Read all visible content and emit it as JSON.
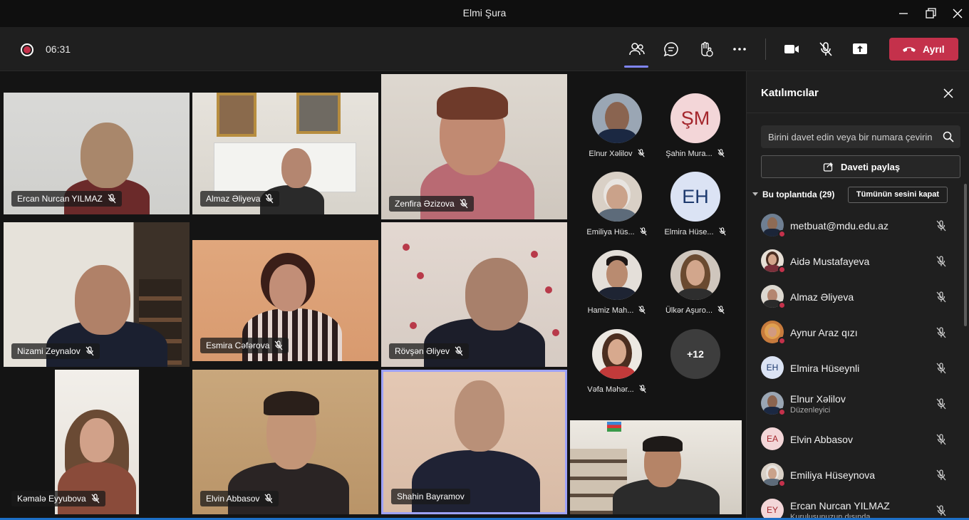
{
  "window": {
    "title": "Elmi Şura"
  },
  "toolbar": {
    "timer": "06:31",
    "leave_label": "Ayrıl"
  },
  "tiles": [
    {
      "name": "Ercan Nurcan YILMAZ"
    },
    {
      "name": "Almaz Əliyeva"
    },
    {
      "name": "Zenfira Əzizova"
    },
    {
      "name": "Nizami Zeynalov"
    },
    {
      "name": "Esmira Cəfərova"
    },
    {
      "name": "Rövşən Əliyev"
    },
    {
      "name": "Kəmalə Eyyubova"
    },
    {
      "name": "Elvin Abbasov"
    },
    {
      "name": "Shahin Bayramov"
    }
  ],
  "avatars": [
    {
      "name": "Elnur Xəlilov"
    },
    {
      "name": "Şahin Mura...",
      "initials": "ŞM"
    },
    {
      "name": "Emiliya Hüs..."
    },
    {
      "name": "Elmira Hüse...",
      "initials": "EH"
    },
    {
      "name": "Hamiz Mah..."
    },
    {
      "name": "Ülkər Aşuro..."
    },
    {
      "name": "Vəfa Məhər..."
    },
    {
      "more": "+12"
    }
  ],
  "panel": {
    "title": "Katılımcılar",
    "search_placeholder": "Birini davet edin veya bir numara çevirin",
    "share_label": "Daveti paylaş",
    "group_label": "Bu toplantıda (29)",
    "mute_all_label": "Tümünün sesini kapat",
    "participants": [
      {
        "name": "metbuat@mdu.edu.az"
      },
      {
        "name": "Aidə Mustafayeva"
      },
      {
        "name": "Almaz Əliyeva"
      },
      {
        "name": "Aynur Araz qızı"
      },
      {
        "name": "Elmira Hüseynli",
        "initials": "EH"
      },
      {
        "name": "Elnur Xəlilov",
        "role": "Düzenleyici"
      },
      {
        "name": "Elvin Abbasov",
        "initials": "EA"
      },
      {
        "name": "Emiliya Hüseynova"
      },
      {
        "name": "Ercan Nurcan YILMAZ",
        "initials": "EY",
        "role": "Kuruluşunuzun dışında"
      }
    ]
  },
  "colors": {
    "leave": "#c4314b",
    "accent": "#7f85f5",
    "recording": "#c4314b"
  },
  "icons": [
    "record-icon",
    "participants-icon",
    "chat-icon",
    "raise-hand-icon",
    "more-icon",
    "camera-icon",
    "mic-off-icon",
    "share-screen-icon",
    "hangup-icon",
    "close-icon",
    "search-icon",
    "share-icon"
  ]
}
